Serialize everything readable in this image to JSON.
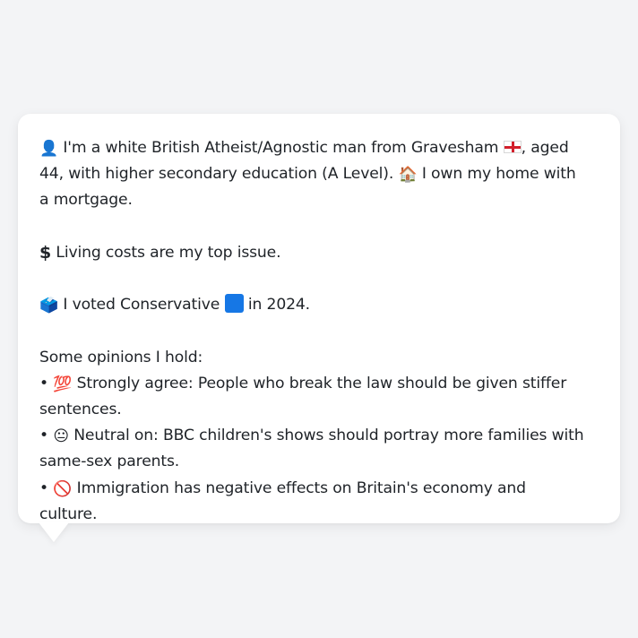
{
  "message": {
    "intro": {
      "person_icon": "👤",
      "text_a": " I'm a white British Atheist/Agnostic man from Gravesham ",
      "flag_icon": "england-flag-icon",
      "text_b": ", aged 44, with higher secondary education (A Level). ",
      "house_icon": "🏠",
      "text_c": " I own my home with a mortgage."
    },
    "issue": {
      "dollar_icon": "💲",
      "text": " Living costs are my top issue."
    },
    "vote": {
      "ballot_icon": "🗳️",
      "text_a": " I voted Conservative ",
      "party_square_icon": "blue-square-icon",
      "party_color": "#1677e5",
      "text_b": " in 2024."
    },
    "opinions_heading": "Some opinions I hold:",
    "opinions": [
      {
        "bullet": "• ",
        "icon": "💯",
        "text": " Strongly agree: People who break the law should be given stiffer sentences."
      },
      {
        "bullet": "• ",
        "icon": "😐",
        "text": " Neutral on: BBC children's shows should portray more families with same-sex parents."
      },
      {
        "bullet": "• ",
        "icon": "🚫",
        "text": " Immigration has negative effects on Britain's economy and culture."
      }
    ]
  }
}
